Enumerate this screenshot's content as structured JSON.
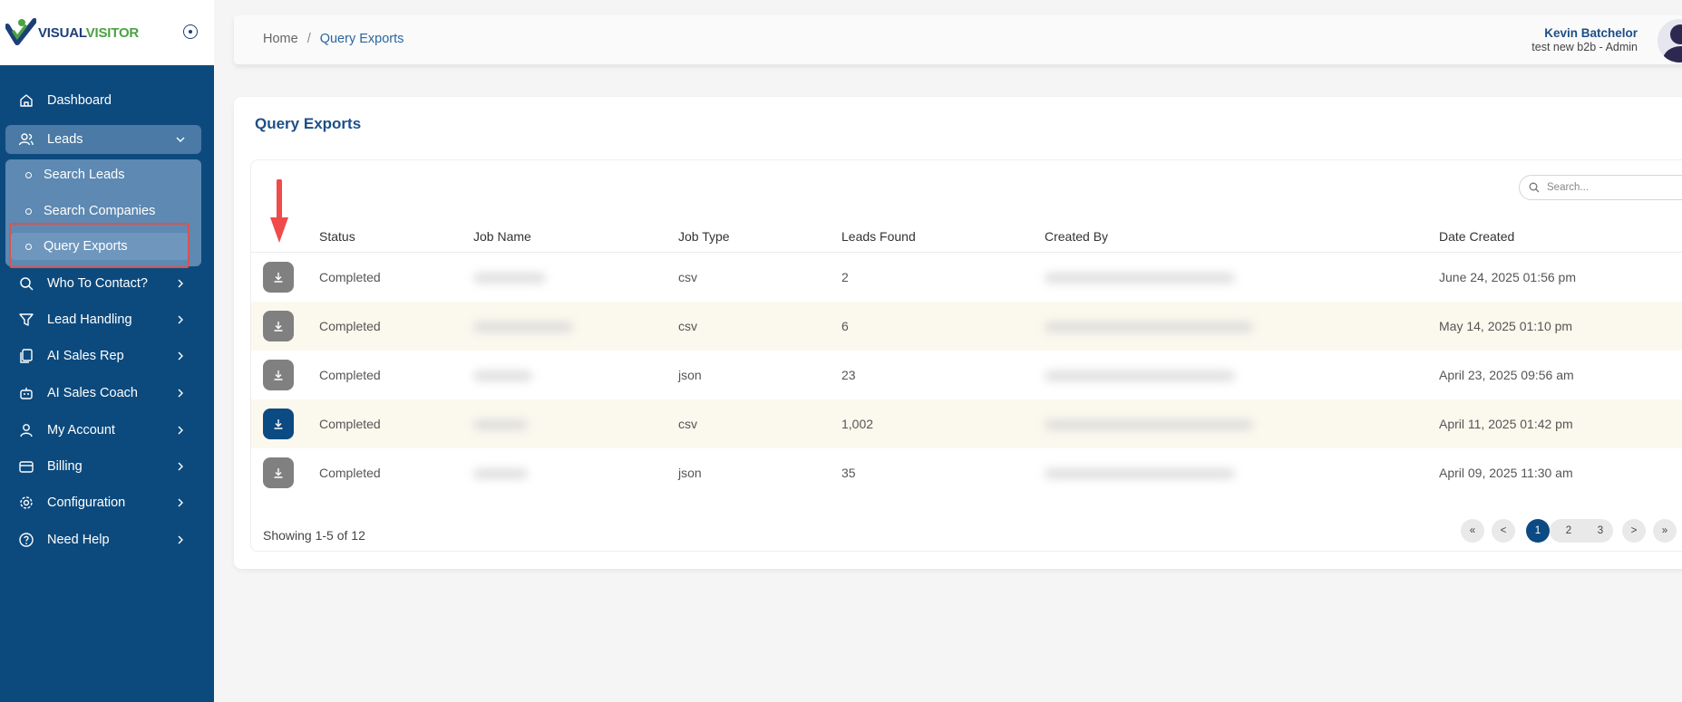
{
  "brand": {
    "part1": "VISUAL",
    "part2": "VISITOR",
    "green": "#4ba243",
    "navy": "#1d3f78"
  },
  "sidebar": {
    "bg": "#0c4a7e",
    "items": [
      {
        "label": "Dashboard",
        "icon": "home-icon"
      },
      {
        "label": "Leads",
        "icon": "users-icon",
        "expanded": true
      },
      {
        "label": "Who To Contact?",
        "icon": "search-icon"
      },
      {
        "label": "Lead Handling",
        "icon": "filter-icon"
      },
      {
        "label": "AI Sales Rep",
        "icon": "copy-icon"
      },
      {
        "label": "AI Sales Coach",
        "icon": "robot-icon"
      },
      {
        "label": "My Account",
        "icon": "user-icon"
      },
      {
        "label": "Billing",
        "icon": "wallet-icon"
      },
      {
        "label": "Configuration",
        "icon": "gear-icon"
      },
      {
        "label": "Need Help",
        "icon": "help-circle-icon"
      }
    ],
    "sub_items": [
      "Search Leads",
      "Search Companies",
      "Query Exports"
    ]
  },
  "header": {
    "breadcrumb": {
      "home": "Home",
      "separator": "/",
      "current": "Query Exports"
    },
    "user": {
      "name": "Kevin Batchelor",
      "role": "test new b2b - Admin"
    }
  },
  "main": {
    "title": "Query Exports",
    "search_placeholder": "Search...",
    "columns": [
      "Status",
      "Job Name",
      "Job Type",
      "Leads Found",
      "Created By",
      "Date Created"
    ],
    "rows": [
      {
        "status": "Completed",
        "job_type": "csv",
        "leads_found": "2",
        "date_created": "June 24, 2025 01:56 pm"
      },
      {
        "status": "Completed",
        "job_type": "csv",
        "leads_found": "6",
        "date_created": "May 14, 2025 01:10 pm"
      },
      {
        "status": "Completed",
        "job_type": "json",
        "leads_found": "23",
        "date_created": "April 23, 2025 09:56 am"
      },
      {
        "status": "Completed",
        "job_type": "csv",
        "leads_found": "1,002",
        "date_created": "April 11, 2025 01:42 pm"
      },
      {
        "status": "Completed",
        "job_type": "json",
        "leads_found": "35",
        "date_created": "April 09, 2025 11:30 am"
      }
    ],
    "showing": "Showing 1-5 of 12",
    "pagination": {
      "first": "«",
      "prev": "<",
      "pages": [
        "1",
        "2",
        "3"
      ],
      "next": ">",
      "last": "»",
      "current": "1"
    }
  },
  "colors": {
    "accent": "#0b4a82",
    "highlight_red": "#d9534f",
    "arrow_red": "#f04b4b"
  }
}
